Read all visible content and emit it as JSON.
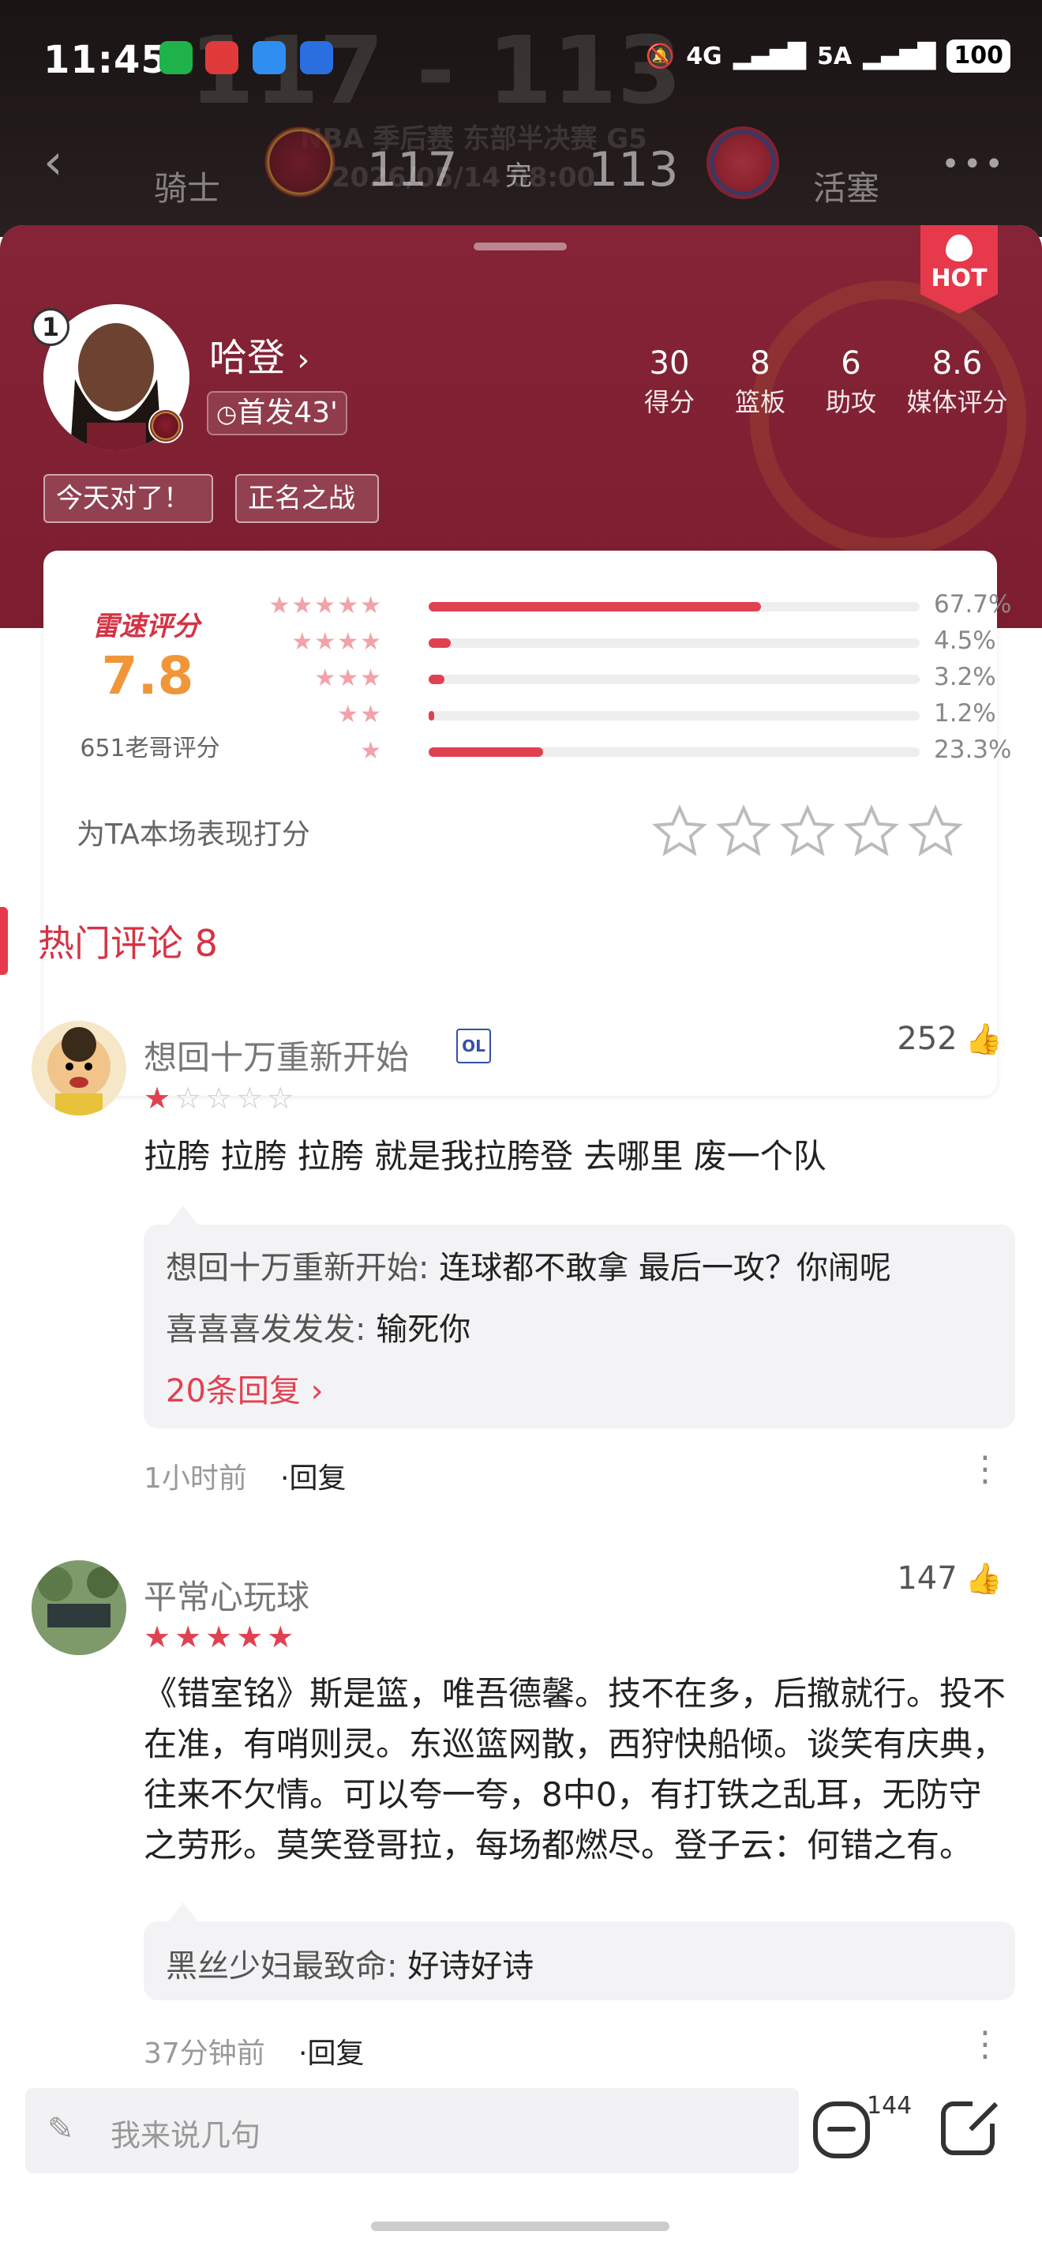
{
  "status_bar": {
    "time": "11:45",
    "network": "4G",
    "network2": "5A",
    "battery": "100"
  },
  "match": {
    "home_team": "骑士",
    "away_team": "活塞",
    "home_score": "117",
    "away_score": "113",
    "status": "完",
    "bg_score": "117 - 113",
    "bg_subtitle": "NBA 季后赛 东部半决赛 G5",
    "bg_date": "2026/05/14 08:00"
  },
  "player": {
    "jersey": "1",
    "name": "哈登",
    "name_chevron": "›",
    "starter_info": "首发43'",
    "hot_label": "HOT",
    "stats": [
      {
        "value": "30",
        "label": "得分"
      },
      {
        "value": "8",
        "label": "篮板"
      },
      {
        "value": "6",
        "label": "助攻"
      },
      {
        "value": "8.6",
        "label": "媒体评分"
      }
    ],
    "tags": [
      "今天对了！",
      "正名之战"
    ]
  },
  "rating": {
    "title": "雷速评分",
    "score": "7.8",
    "count_text": "651老哥评分",
    "distribution": [
      {
        "stars": "★★★★★",
        "percent": "67.7%",
        "fraction": 0.677
      },
      {
        "stars": "★★★★",
        "percent": "4.5%",
        "fraction": 0.045
      },
      {
        "stars": "★★★",
        "percent": "3.2%",
        "fraction": 0.032
      },
      {
        "stars": "★★",
        "percent": "1.2%",
        "fraction": 0.012
      },
      {
        "stars": "★",
        "percent": "23.3%",
        "fraction": 0.233
      }
    ],
    "prompt": "为TA本场表现打分"
  },
  "comments_section": {
    "title": "热门评论 8"
  },
  "comments": [
    {
      "user": "想回十万重新开始",
      "likes": "252",
      "stars": 1,
      "text": "拉胯 拉胯 拉胯 就是我拉胯登 去哪里 废一个队",
      "replies": [
        {
          "who": "想回十万重新开始:",
          "text": "连球都不敢拿 最后一攻？你闹呢"
        },
        {
          "who": "喜喜喜发发发:",
          "text": "输死你"
        }
      ],
      "more_replies": "20条回复 ›",
      "time": "1小时前",
      "reply_label": "·回复"
    },
    {
      "user": "平常心玩球",
      "likes": "147",
      "stars": 5,
      "text": "《错室铭》斯是篮，唯吾德馨。技不在多，后撤就行。投不在准，有哨则灵。东巡篮网散，西狩快船倾。谈笑有庆典，往来不欠情。可以夸一夸，8中0，有打铁之乱耳，无防守之劳形。莫笑登哥拉，每场都燃尽。登子云：何错之有。",
      "replies": [
        {
          "who": "黑丝少妇最致命:",
          "text": "好诗好诗"
        }
      ],
      "time": "37分钟前",
      "reply_label": "·回复"
    }
  ],
  "bottom_bar": {
    "placeholder": "我来说几句",
    "comment_count": "144"
  },
  "colors": {
    "accent": "#e04151",
    "header": "#842436",
    "score_orange": "#f0963a"
  }
}
